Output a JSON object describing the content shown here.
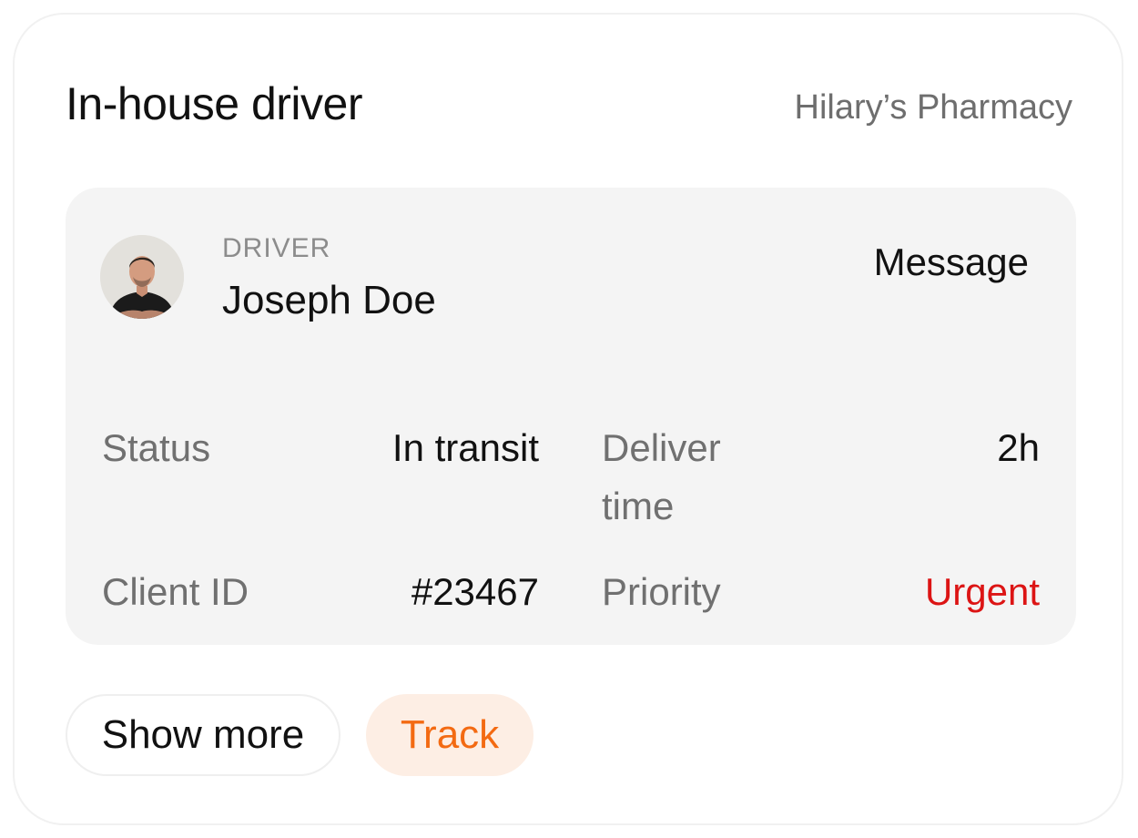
{
  "header": {
    "title": "In-house driver",
    "merchant": "Hilary’s Pharmacy"
  },
  "driver": {
    "caption": "DRIVER",
    "name": "Joseph Doe",
    "message_label": "Message"
  },
  "details": {
    "status_label": "Status",
    "status_value": "In transit",
    "deliver_time_label": "Deliver time",
    "deliver_time_value": "2h",
    "client_id_label": "Client ID",
    "client_id_value": "#23467",
    "priority_label": "Priority",
    "priority_value": "Urgent"
  },
  "actions": {
    "show_more_label": "Show more",
    "track_label": "Track"
  },
  "colors": {
    "accent": "#f36a12",
    "accent_bg": "#fdeee4",
    "urgent": "#dc1414",
    "panel_bg": "#f4f4f4"
  },
  "icons": {
    "avatar": "driver-photo"
  }
}
